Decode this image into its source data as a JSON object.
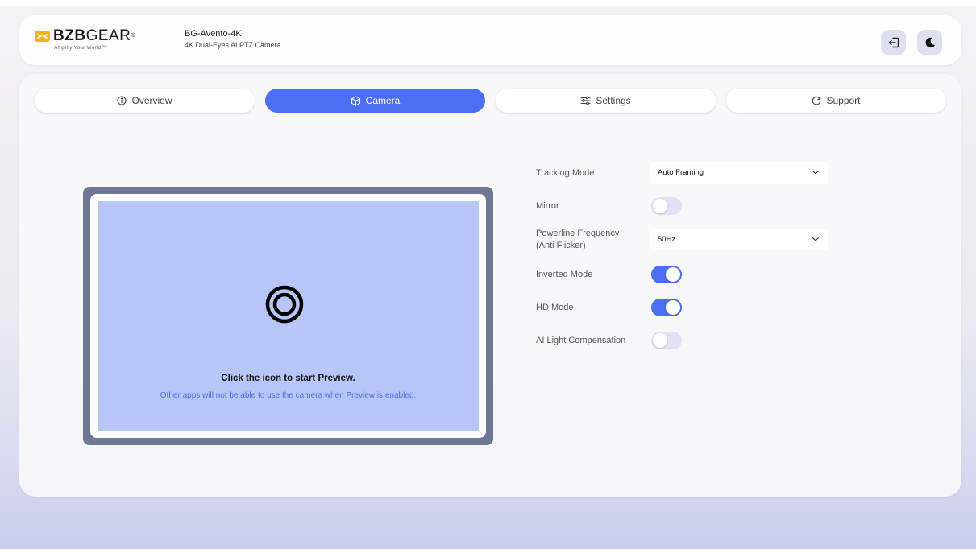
{
  "brand": {
    "name_bold": "BZB",
    "name_light": "GEAR",
    "reg": "®",
    "tagline": "Amplify Your World™",
    "accent": "#f2b21c"
  },
  "device": {
    "name": "BG-Avento-4K",
    "model": "4K Dual-Eyes AI PTZ Camera"
  },
  "header": {
    "logout_icon": "logout-icon",
    "theme_icon": "moon-icon"
  },
  "tabs": [
    {
      "label": "Overview",
      "icon": "info-icon",
      "active": false
    },
    {
      "label": "Camera",
      "icon": "cube-icon",
      "active": true
    },
    {
      "label": "Settings",
      "icon": "sliders-icon",
      "active": false
    },
    {
      "label": "Support",
      "icon": "refresh-icon",
      "active": false
    }
  ],
  "preview": {
    "title": "Click the icon to start Preview.",
    "note": "Other apps will not be able to use the camera when Preview is enabled."
  },
  "settings": {
    "tracking_mode": {
      "label": "Tracking Mode",
      "value": "Auto Framing"
    },
    "mirror": {
      "label": "Mirror",
      "on": false
    },
    "powerline": {
      "label_line1": "Powerline Frequency",
      "label_line2": "(Anti Flicker)",
      "value": "50Hz"
    },
    "inverted": {
      "label": "Inverted Mode",
      "on": true
    },
    "hd": {
      "label": "HD Mode",
      "on": true
    },
    "ai_light": {
      "label": "AI Light Compensation",
      "on": false
    }
  },
  "colors": {
    "primary": "#4c6ef0",
    "preview_bg": "#b7c5f7",
    "frame": "#6e7892"
  }
}
